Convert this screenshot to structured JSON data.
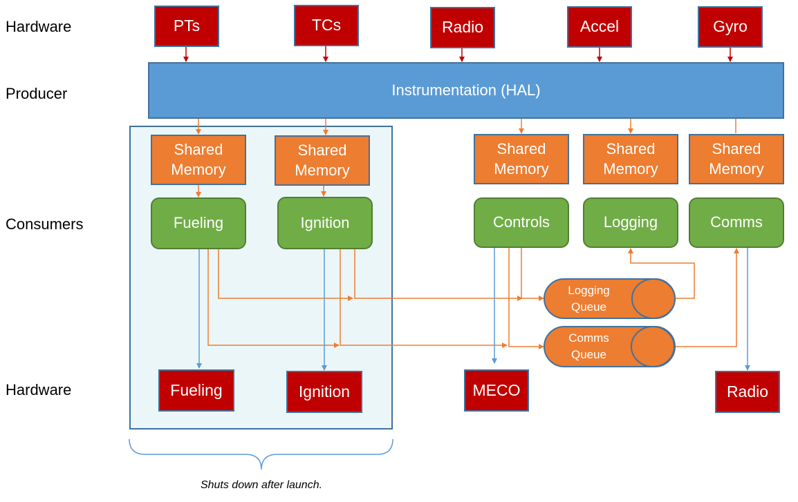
{
  "row_labels": {
    "hardware_top": "Hardware",
    "producer": "Producer",
    "consumers": "Consumers",
    "hardware_bottom": "Hardware"
  },
  "inputs": [
    "PTs",
    "TCs",
    "Radio",
    "Accel",
    "Gyro"
  ],
  "producer": "Instrumentation (HAL)",
  "shared_memory": "Shared Memory",
  "consumers": [
    "Fueling",
    "Ignition",
    "Controls",
    "Logging",
    "Comms"
  ],
  "queues": {
    "logging": [
      "Logging",
      "Queue"
    ],
    "comms": [
      "Comms",
      "Queue"
    ]
  },
  "outputs": [
    "Fueling",
    "Ignition",
    "MECO",
    "Radio"
  ],
  "note": "Shuts down after launch.",
  "colors": {
    "hardware": "#c00000",
    "producer": "#5b9bd5",
    "shared_memory": "#ed7d31",
    "consumer": "#70ad47",
    "data_flow": "#ed7d31",
    "control_flow": "#5b9bd5"
  }
}
